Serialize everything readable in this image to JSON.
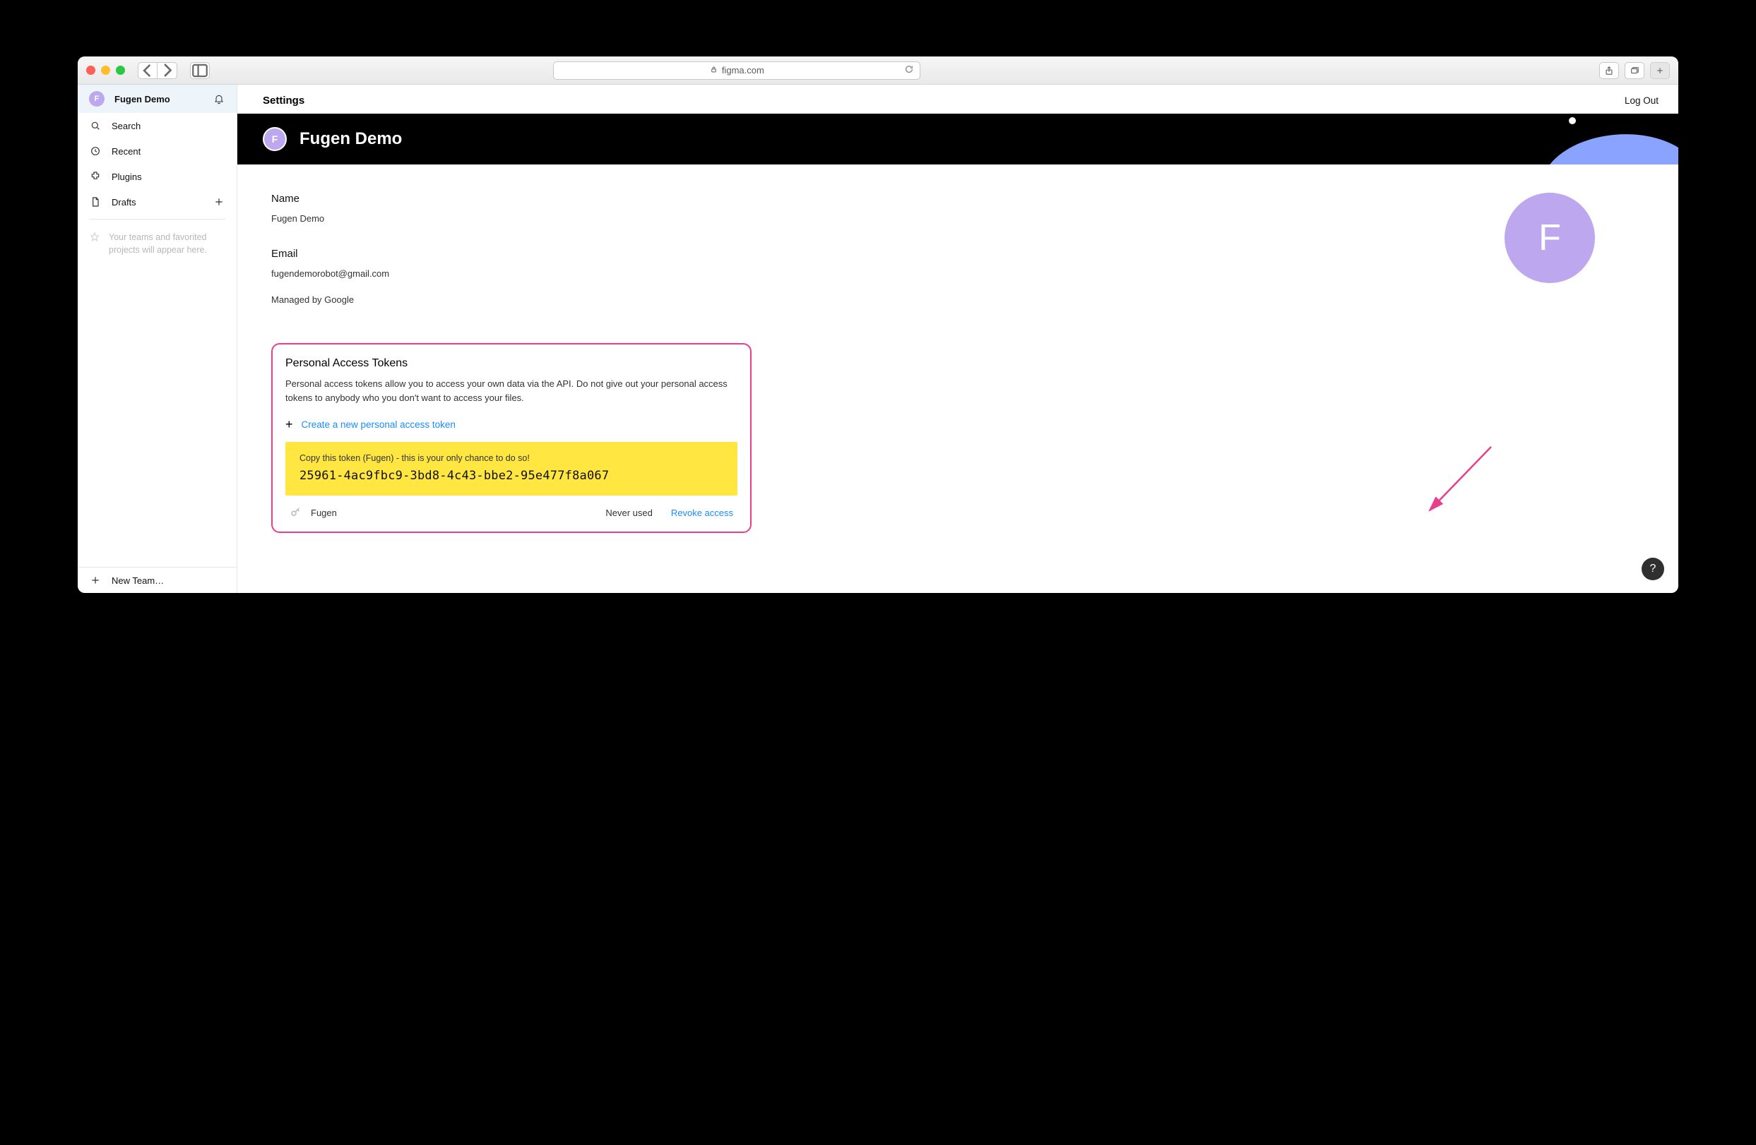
{
  "browser": {
    "url_label": "figma.com"
  },
  "sidebar": {
    "user": {
      "initial": "F",
      "name": "Fugen Demo"
    },
    "items": {
      "search": "Search",
      "recent": "Recent",
      "plugins": "Plugins",
      "drafts": "Drafts"
    },
    "hint": "Your teams and favorited projects will appear here.",
    "new_team": "New Team…"
  },
  "topbar": {
    "title": "Settings",
    "logout": "Log Out"
  },
  "hero": {
    "initial": "F",
    "name": "Fugen Demo"
  },
  "profile": {
    "name_label": "Name",
    "name_value": "Fugen Demo",
    "email_label": "Email",
    "email_value": "fugendemorobot@gmail.com",
    "managed": "Managed by Google",
    "avatar_initial": "F"
  },
  "pat": {
    "heading": "Personal Access Tokens",
    "desc": "Personal access tokens allow you to access your own data via the API. Do not give out your personal access tokens to anybody who you don't want to access your files.",
    "create_label": "Create a new personal access token",
    "copy_hint": "Copy this token (Fugen) - this is your only chance to do so!",
    "token_value": "25961-4ac9fbc9-3bd8-4c43-bbe2-95e477f8a067",
    "token_name": "Fugen",
    "status": "Never used",
    "revoke": "Revoke access"
  },
  "help": "?"
}
